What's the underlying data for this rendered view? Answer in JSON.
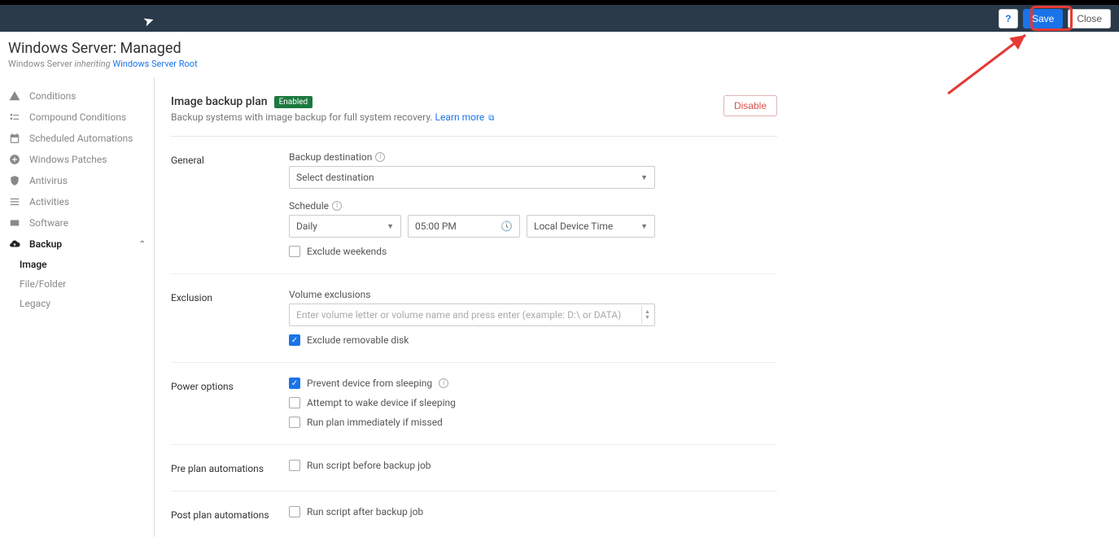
{
  "topbar": {
    "help_label": "?",
    "save_label": "Save",
    "close_label": "Close"
  },
  "header": {
    "title": "Windows Server: Managed",
    "subtitle_prefix": "Windows Server ",
    "subtitle_inheriting": "inheriting",
    "subtitle_link": "Windows Server Root"
  },
  "sidebar": {
    "items": [
      {
        "label": "Conditions",
        "icon": "warning"
      },
      {
        "label": "Compound Conditions",
        "icon": "compound"
      },
      {
        "label": "Scheduled Automations",
        "icon": "calendar"
      },
      {
        "label": "Windows Patches",
        "icon": "plus-circle"
      },
      {
        "label": "Antivirus",
        "icon": "shield"
      },
      {
        "label": "Activities",
        "icon": "list"
      },
      {
        "label": "Software",
        "icon": "card"
      }
    ],
    "backup": {
      "label": "Backup",
      "children": [
        {
          "label": "Image"
        },
        {
          "label": "File/Folder"
        },
        {
          "label": "Legacy"
        }
      ]
    }
  },
  "section": {
    "title": "Image backup plan",
    "badge": "Enabled",
    "description_text": "Backup systems with image backup for full system recovery.",
    "learn_more": "Learn more",
    "disable_label": "Disable"
  },
  "general": {
    "row_label": "General",
    "backup_destination_label": "Backup destination",
    "backup_destination_value": "Select destination",
    "schedule_label": "Schedule",
    "schedule_freq": "Daily",
    "schedule_time": "05:00 PM",
    "schedule_tz": "Local Device Time",
    "exclude_weekends": "Exclude weekends"
  },
  "exclusion": {
    "row_label": "Exclusion",
    "vol_excl_label": "Volume exclusions",
    "vol_excl_placeholder": "Enter volume letter or volume name and press enter (example: D:\\ or DATA)",
    "exclude_removable": "Exclude removable disk"
  },
  "power": {
    "row_label": "Power options",
    "prevent_sleep": "Prevent device from sleeping",
    "attempt_wake": "Attempt to wake device if sleeping",
    "run_if_missed": "Run plan immediately if missed"
  },
  "pre_plan": {
    "row_label": "Pre plan automations",
    "run_before": "Run script before backup job"
  },
  "post_plan": {
    "row_label": "Post plan automations",
    "run_after": "Run script after backup job"
  }
}
